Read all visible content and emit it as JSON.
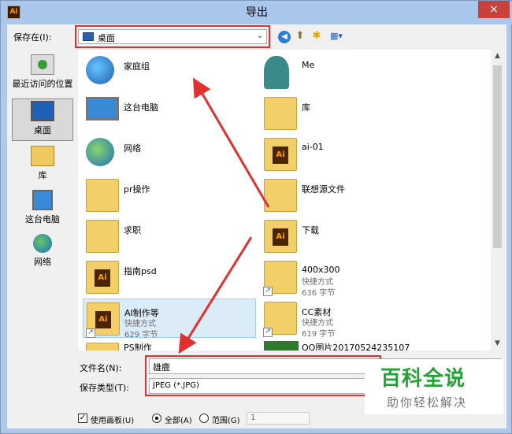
{
  "window": {
    "app_icon": "Ai",
    "title": "导出",
    "close_icon": "×"
  },
  "toolbar": {
    "save_in_label": "保存在(I):",
    "location_value": "桌面",
    "icons": [
      "back-icon",
      "up-folder-icon",
      "new-folder-icon",
      "view-menu-icon"
    ]
  },
  "places": [
    {
      "label": "最近访问的位置",
      "icon": "recent-places-icon"
    },
    {
      "label": "桌面",
      "icon": "desktop-icon",
      "selected": true
    },
    {
      "label": "库",
      "icon": "libraries-icon"
    },
    {
      "label": "这台电脑",
      "icon": "this-pc-icon"
    },
    {
      "label": "网络",
      "icon": "network-icon"
    }
  ],
  "files": {
    "left": [
      {
        "name": "家庭组",
        "icon": "homegroup-icon"
      },
      {
        "name": "这台电脑",
        "icon": "this-pc-icon"
      },
      {
        "name": "网络",
        "icon": "network-icon"
      },
      {
        "name": "pr操作",
        "icon": "folder-icon"
      },
      {
        "name": "求职",
        "icon": "folder-icon"
      },
      {
        "name": "指南psd",
        "icon": "folder-icon"
      },
      {
        "name": "AI制作等",
        "sub1": "快捷方式",
        "sub2": "629 字节",
        "icon": "folder-shortcut-icon",
        "selected": true
      },
      {
        "name": "PS制作",
        "icon": "folder-icon"
      }
    ],
    "right": [
      {
        "name": "Me",
        "icon": "user-icon"
      },
      {
        "name": "库",
        "icon": "libraries-icon"
      },
      {
        "name": "ai-01",
        "icon": "folder-icon"
      },
      {
        "name": "联想源文件",
        "icon": "folder-icon"
      },
      {
        "name": "下载",
        "icon": "folder-icon"
      },
      {
        "name": "400x300",
        "sub1": "快捷方式",
        "sub2": "636 字节",
        "icon": "folder-shortcut-icon"
      },
      {
        "name": "CC素材",
        "sub1": "快捷方式",
        "sub2": "619 字节",
        "icon": "folder-shortcut-icon"
      },
      {
        "name": "QQ图片20170524235107",
        "icon": "image-icon"
      }
    ]
  },
  "form": {
    "filename_label": "文件名(N):",
    "filename_value": "雄鹿",
    "filetype_label": "保存类型(T):",
    "filetype_value": "JPEG (*.JPG)"
  },
  "options": {
    "use_artboards_label": "使用画板(U)",
    "use_artboards_checked": true,
    "all_label": "全部(A)",
    "range_label": "范围(G)",
    "range_value": "1"
  },
  "watermark": {
    "title": "百科全说",
    "subtitle": "助你轻松解决"
  },
  "colors": {
    "titlebar": "#a9c6ec",
    "close_button": "#c8413a",
    "annotation_red": "#e03030",
    "selection": "#dbecf8",
    "watermark_green": "#23a236"
  }
}
